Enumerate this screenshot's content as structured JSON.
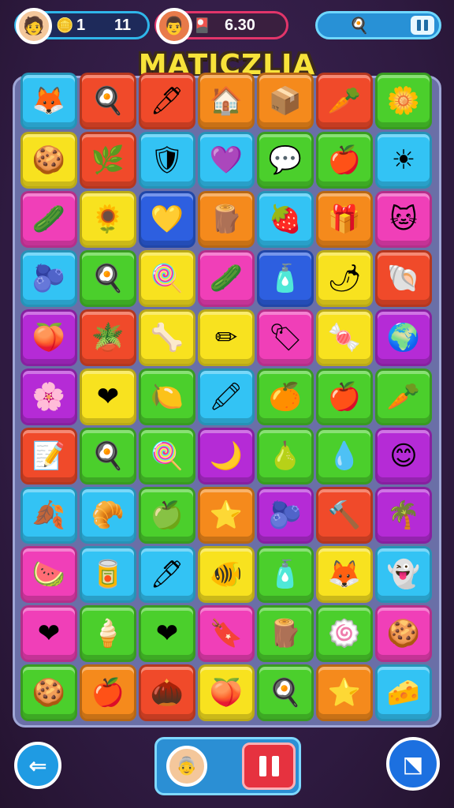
{
  "header": {
    "player_score": "11",
    "player_bonus": "1",
    "opponent_score": "6.30",
    "title": "MATICZLIA"
  },
  "icons": {
    "player_avatar": "player-avatar",
    "coin": "coin-icon",
    "opponent_avatar": "opponent-avatar",
    "card": "card-icon",
    "egg": "egg-icon",
    "pause": "pause-icon",
    "back": "back-arrow-icon",
    "share": "share-icon"
  },
  "colors": {
    "R": "#f04a2a",
    "O": "#f58a1c",
    "Y": "#f8e21f",
    "G": "#4bcf2c",
    "C": "#33c3f4",
    "B": "#2d5fe0",
    "P": "#b52bd6",
    "M": "#f03fb8"
  },
  "board": {
    "rows": [
      [
        {
          "c": "C",
          "i": "🦊",
          "n": "fox"
        },
        {
          "c": "R",
          "i": "🍳",
          "n": "pan"
        },
        {
          "c": "R",
          "i": "🖊",
          "n": "pen"
        },
        {
          "c": "O",
          "i": "🏠",
          "n": "house"
        },
        {
          "c": "O",
          "i": "📦",
          "n": "box"
        },
        {
          "c": "R",
          "i": "🥕",
          "n": "carrot"
        },
        {
          "c": "G",
          "i": "🌼",
          "n": "flower"
        }
      ],
      [
        {
          "c": "Y",
          "i": "🍪",
          "n": "cookie"
        },
        {
          "c": "R",
          "i": "🌿",
          "n": "leaf"
        },
        {
          "c": "C",
          "i": "🛡",
          "n": "shield"
        },
        {
          "c": "C",
          "i": "💜",
          "n": "roller"
        },
        {
          "c": "G",
          "i": "💬",
          "n": "bubble"
        },
        {
          "c": "G",
          "i": "🍎",
          "n": "apple"
        },
        {
          "c": "C",
          "i": "☀",
          "n": "sun"
        }
      ],
      [
        {
          "c": "M",
          "i": "🥒",
          "n": "pickle"
        },
        {
          "c": "Y",
          "i": "🌻",
          "n": "sunflower"
        },
        {
          "c": "B",
          "i": "💛",
          "n": "heart"
        },
        {
          "c": "O",
          "i": "🪵",
          "n": "log"
        },
        {
          "c": "C",
          "i": "🍓",
          "n": "strawberry"
        },
        {
          "c": "O",
          "i": "🎁",
          "n": "gift"
        },
        {
          "c": "M",
          "i": "🐱",
          "n": "cat"
        }
      ],
      [
        {
          "c": "C",
          "i": "🫐",
          "n": "berry"
        },
        {
          "c": "G",
          "i": "🍳",
          "n": "pan"
        },
        {
          "c": "Y",
          "i": "🍭",
          "n": "lollipop"
        },
        {
          "c": "M",
          "i": "🥒",
          "n": "cucumber"
        },
        {
          "c": "B",
          "i": "🧴",
          "n": "bottle"
        },
        {
          "c": "Y",
          "i": "🌶",
          "n": "pepper"
        },
        {
          "c": "R",
          "i": "🐚",
          "n": "shell"
        }
      ],
      [
        {
          "c": "P",
          "i": "🍑",
          "n": "peach"
        },
        {
          "c": "R",
          "i": "🪴",
          "n": "plant"
        },
        {
          "c": "Y",
          "i": "🦴",
          "n": "bone"
        },
        {
          "c": "Y",
          "i": "✏",
          "n": "pencil"
        },
        {
          "c": "M",
          "i": "🏷",
          "n": "tag"
        },
        {
          "c": "Y",
          "i": "🍬",
          "n": "candy"
        },
        {
          "c": "P",
          "i": "🌍",
          "n": "globe"
        }
      ],
      [
        {
          "c": "P",
          "i": "🌸",
          "n": "blossom"
        },
        {
          "c": "Y",
          "i": "❤",
          "n": "heart"
        },
        {
          "c": "G",
          "i": "🍋",
          "n": "lemon"
        },
        {
          "c": "C",
          "i": "🖍",
          "n": "crayon"
        },
        {
          "c": "G",
          "i": "🍊",
          "n": "orange"
        },
        {
          "c": "G",
          "i": "🍎",
          "n": "apple"
        },
        {
          "c": "G",
          "i": "🥕",
          "n": "carrot"
        }
      ],
      [
        {
          "c": "R",
          "i": "📝",
          "n": "note"
        },
        {
          "c": "G",
          "i": "🍳",
          "n": "pan"
        },
        {
          "c": "G",
          "i": "🍭",
          "n": "lollipop"
        },
        {
          "c": "P",
          "i": "🌙",
          "n": "moon"
        },
        {
          "c": "G",
          "i": "🍐",
          "n": "pear"
        },
        {
          "c": "G",
          "i": "💧",
          "n": "drop"
        },
        {
          "c": "P",
          "i": "😊",
          "n": "smile"
        }
      ],
      [
        {
          "c": "C",
          "i": "🍂",
          "n": "leaves"
        },
        {
          "c": "C",
          "i": "🥐",
          "n": "croissant"
        },
        {
          "c": "G",
          "i": "🍏",
          "n": "green-apple"
        },
        {
          "c": "O",
          "i": "⭐",
          "n": "star"
        },
        {
          "c": "P",
          "i": "🫐",
          "n": "berry"
        },
        {
          "c": "R",
          "i": "🔨",
          "n": "hammer"
        },
        {
          "c": "P",
          "i": "🌴",
          "n": "palm"
        }
      ],
      [
        {
          "c": "M",
          "i": "🍉",
          "n": "watermelon"
        },
        {
          "c": "C",
          "i": "🥫",
          "n": "can"
        },
        {
          "c": "C",
          "i": "🖊",
          "n": "marker"
        },
        {
          "c": "Y",
          "i": "🐠",
          "n": "fish"
        },
        {
          "c": "G",
          "i": "🧴",
          "n": "lotion"
        },
        {
          "c": "Y",
          "i": "🦊",
          "n": "fox"
        },
        {
          "c": "C",
          "i": "👻",
          "n": "ghost"
        }
      ],
      [
        {
          "c": "M",
          "i": "❤",
          "n": "heart"
        },
        {
          "c": "G",
          "i": "🍦",
          "n": "icecream"
        },
        {
          "c": "G",
          "i": "❤",
          "n": "heart"
        },
        {
          "c": "M",
          "i": "🔖",
          "n": "label"
        },
        {
          "c": "G",
          "i": "🪵",
          "n": "wood"
        },
        {
          "c": "G",
          "i": "🍥",
          "n": "swirl"
        },
        {
          "c": "M",
          "i": "🍪",
          "n": "cookie"
        }
      ],
      [
        {
          "c": "G",
          "i": "🍪",
          "n": "cookie"
        },
        {
          "c": "O",
          "i": "🍎",
          "n": "apple"
        },
        {
          "c": "R",
          "i": "🌰",
          "n": "nut"
        },
        {
          "c": "Y",
          "i": "🍑",
          "n": "peach"
        },
        {
          "c": "G",
          "i": "🍳",
          "n": "pan"
        },
        {
          "c": "O",
          "i": "⭐",
          "n": "star"
        },
        {
          "c": "C",
          "i": "🧀",
          "n": "cheese"
        }
      ]
    ]
  }
}
